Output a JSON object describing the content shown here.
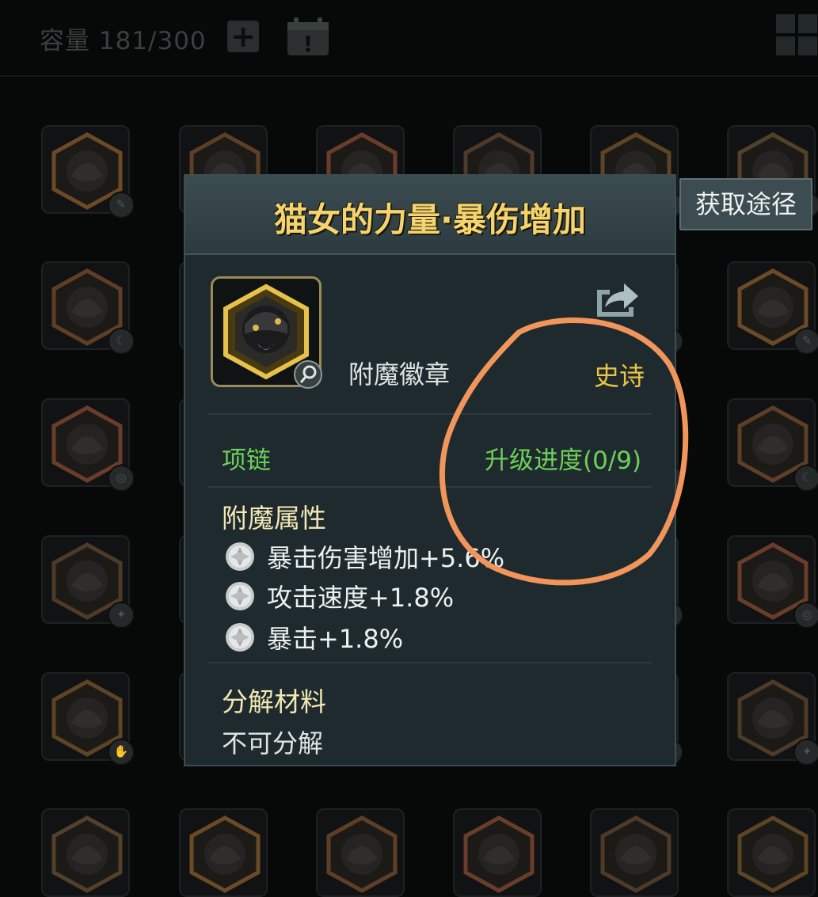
{
  "topbar": {
    "capacity_label": "容量",
    "capacity_value": "181/300",
    "add_icon": "plus-icon",
    "event_icon": "calendar-alert-icon",
    "grid_icon": "grid-view-icon"
  },
  "popup": {
    "title": "猫女的力量·暴伤增加",
    "obtain_button": "获取途径",
    "item_type": "附魔徽章",
    "rarity": "史诗",
    "slot_type": "项链",
    "upgrade_progress": "升级进度(0/9)",
    "attributes_title": "附魔属性",
    "attributes": [
      "暴击伤害增加+5.6%",
      "攻击速度+1.8%",
      "暴击+1.8%"
    ],
    "decompose_title": "分解材料",
    "decompose_value": "不可分解"
  },
  "colors": {
    "title_gold": "#f4d46e",
    "rarity_gold": "#e8c545",
    "green": "#6ed05a",
    "annotation_orange": "#f2955a"
  }
}
